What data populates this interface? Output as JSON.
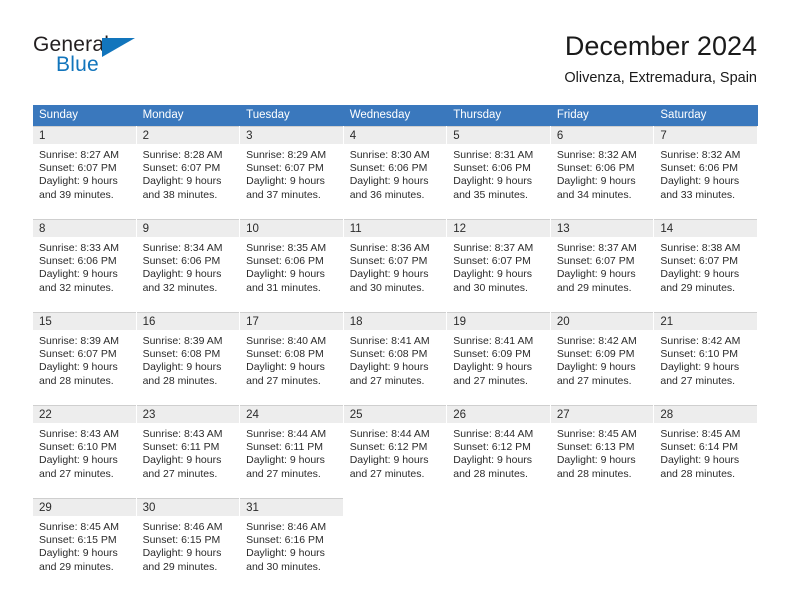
{
  "brand": {
    "name_top": "General",
    "name_bottom": "Blue",
    "accent_color": "#1275bc",
    "logo_icon": "triangle-icon"
  },
  "header": {
    "title": "December 2024",
    "subtitle": "Olivenza, Extremadura, Spain"
  },
  "theme": {
    "header_row_bg": "#3a78bd",
    "header_row_text": "#ffffff",
    "daynum_bg": "#ededed",
    "cell_bg": "#ffffff",
    "text": "#2b2b2b"
  },
  "weekday_headers": [
    "Sunday",
    "Monday",
    "Tuesday",
    "Wednesday",
    "Thursday",
    "Friday",
    "Saturday"
  ],
  "weeks": [
    [
      {
        "day": "1",
        "sunrise": "Sunrise: 8:27 AM",
        "sunset": "Sunset: 6:07 PM",
        "daylight1": "Daylight: 9 hours",
        "daylight2": "and 39 minutes."
      },
      {
        "day": "2",
        "sunrise": "Sunrise: 8:28 AM",
        "sunset": "Sunset: 6:07 PM",
        "daylight1": "Daylight: 9 hours",
        "daylight2": "and 38 minutes."
      },
      {
        "day": "3",
        "sunrise": "Sunrise: 8:29 AM",
        "sunset": "Sunset: 6:07 PM",
        "daylight1": "Daylight: 9 hours",
        "daylight2": "and 37 minutes."
      },
      {
        "day": "4",
        "sunrise": "Sunrise: 8:30 AM",
        "sunset": "Sunset: 6:06 PM",
        "daylight1": "Daylight: 9 hours",
        "daylight2": "and 36 minutes."
      },
      {
        "day": "5",
        "sunrise": "Sunrise: 8:31 AM",
        "sunset": "Sunset: 6:06 PM",
        "daylight1": "Daylight: 9 hours",
        "daylight2": "and 35 minutes."
      },
      {
        "day": "6",
        "sunrise": "Sunrise: 8:32 AM",
        "sunset": "Sunset: 6:06 PM",
        "daylight1": "Daylight: 9 hours",
        "daylight2": "and 34 minutes."
      },
      {
        "day": "7",
        "sunrise": "Sunrise: 8:32 AM",
        "sunset": "Sunset: 6:06 PM",
        "daylight1": "Daylight: 9 hours",
        "daylight2": "and 33 minutes."
      }
    ],
    [
      {
        "day": "8",
        "sunrise": "Sunrise: 8:33 AM",
        "sunset": "Sunset: 6:06 PM",
        "daylight1": "Daylight: 9 hours",
        "daylight2": "and 32 minutes."
      },
      {
        "day": "9",
        "sunrise": "Sunrise: 8:34 AM",
        "sunset": "Sunset: 6:06 PM",
        "daylight1": "Daylight: 9 hours",
        "daylight2": "and 32 minutes."
      },
      {
        "day": "10",
        "sunrise": "Sunrise: 8:35 AM",
        "sunset": "Sunset: 6:06 PM",
        "daylight1": "Daylight: 9 hours",
        "daylight2": "and 31 minutes."
      },
      {
        "day": "11",
        "sunrise": "Sunrise: 8:36 AM",
        "sunset": "Sunset: 6:07 PM",
        "daylight1": "Daylight: 9 hours",
        "daylight2": "and 30 minutes."
      },
      {
        "day": "12",
        "sunrise": "Sunrise: 8:37 AM",
        "sunset": "Sunset: 6:07 PM",
        "daylight1": "Daylight: 9 hours",
        "daylight2": "and 30 minutes."
      },
      {
        "day": "13",
        "sunrise": "Sunrise: 8:37 AM",
        "sunset": "Sunset: 6:07 PM",
        "daylight1": "Daylight: 9 hours",
        "daylight2": "and 29 minutes."
      },
      {
        "day": "14",
        "sunrise": "Sunrise: 8:38 AM",
        "sunset": "Sunset: 6:07 PM",
        "daylight1": "Daylight: 9 hours",
        "daylight2": "and 29 minutes."
      }
    ],
    [
      {
        "day": "15",
        "sunrise": "Sunrise: 8:39 AM",
        "sunset": "Sunset: 6:07 PM",
        "daylight1": "Daylight: 9 hours",
        "daylight2": "and 28 minutes."
      },
      {
        "day": "16",
        "sunrise": "Sunrise: 8:39 AM",
        "sunset": "Sunset: 6:08 PM",
        "daylight1": "Daylight: 9 hours",
        "daylight2": "and 28 minutes."
      },
      {
        "day": "17",
        "sunrise": "Sunrise: 8:40 AM",
        "sunset": "Sunset: 6:08 PM",
        "daylight1": "Daylight: 9 hours",
        "daylight2": "and 27 minutes."
      },
      {
        "day": "18",
        "sunrise": "Sunrise: 8:41 AM",
        "sunset": "Sunset: 6:08 PM",
        "daylight1": "Daylight: 9 hours",
        "daylight2": "and 27 minutes."
      },
      {
        "day": "19",
        "sunrise": "Sunrise: 8:41 AM",
        "sunset": "Sunset: 6:09 PM",
        "daylight1": "Daylight: 9 hours",
        "daylight2": "and 27 minutes."
      },
      {
        "day": "20",
        "sunrise": "Sunrise: 8:42 AM",
        "sunset": "Sunset: 6:09 PM",
        "daylight1": "Daylight: 9 hours",
        "daylight2": "and 27 minutes."
      },
      {
        "day": "21",
        "sunrise": "Sunrise: 8:42 AM",
        "sunset": "Sunset: 6:10 PM",
        "daylight1": "Daylight: 9 hours",
        "daylight2": "and 27 minutes."
      }
    ],
    [
      {
        "day": "22",
        "sunrise": "Sunrise: 8:43 AM",
        "sunset": "Sunset: 6:10 PM",
        "daylight1": "Daylight: 9 hours",
        "daylight2": "and 27 minutes."
      },
      {
        "day": "23",
        "sunrise": "Sunrise: 8:43 AM",
        "sunset": "Sunset: 6:11 PM",
        "daylight1": "Daylight: 9 hours",
        "daylight2": "and 27 minutes."
      },
      {
        "day": "24",
        "sunrise": "Sunrise: 8:44 AM",
        "sunset": "Sunset: 6:11 PM",
        "daylight1": "Daylight: 9 hours",
        "daylight2": "and 27 minutes."
      },
      {
        "day": "25",
        "sunrise": "Sunrise: 8:44 AM",
        "sunset": "Sunset: 6:12 PM",
        "daylight1": "Daylight: 9 hours",
        "daylight2": "and 27 minutes."
      },
      {
        "day": "26",
        "sunrise": "Sunrise: 8:44 AM",
        "sunset": "Sunset: 6:12 PM",
        "daylight1": "Daylight: 9 hours",
        "daylight2": "and 28 minutes."
      },
      {
        "day": "27",
        "sunrise": "Sunrise: 8:45 AM",
        "sunset": "Sunset: 6:13 PM",
        "daylight1": "Daylight: 9 hours",
        "daylight2": "and 28 minutes."
      },
      {
        "day": "28",
        "sunrise": "Sunrise: 8:45 AM",
        "sunset": "Sunset: 6:14 PM",
        "daylight1": "Daylight: 9 hours",
        "daylight2": "and 28 minutes."
      }
    ],
    [
      {
        "day": "29",
        "sunrise": "Sunrise: 8:45 AM",
        "sunset": "Sunset: 6:15 PM",
        "daylight1": "Daylight: 9 hours",
        "daylight2": "and 29 minutes."
      },
      {
        "day": "30",
        "sunrise": "Sunrise: 8:46 AM",
        "sunset": "Sunset: 6:15 PM",
        "daylight1": "Daylight: 9 hours",
        "daylight2": "and 29 minutes."
      },
      {
        "day": "31",
        "sunrise": "Sunrise: 8:46 AM",
        "sunset": "Sunset: 6:16 PM",
        "daylight1": "Daylight: 9 hours",
        "daylight2": "and 30 minutes."
      },
      {
        "day": "",
        "sunrise": "",
        "sunset": "",
        "daylight1": "",
        "daylight2": ""
      },
      {
        "day": "",
        "sunrise": "",
        "sunset": "",
        "daylight1": "",
        "daylight2": ""
      },
      {
        "day": "",
        "sunrise": "",
        "sunset": "",
        "daylight1": "",
        "daylight2": ""
      },
      {
        "day": "",
        "sunrise": "",
        "sunset": "",
        "daylight1": "",
        "daylight2": ""
      }
    ]
  ]
}
